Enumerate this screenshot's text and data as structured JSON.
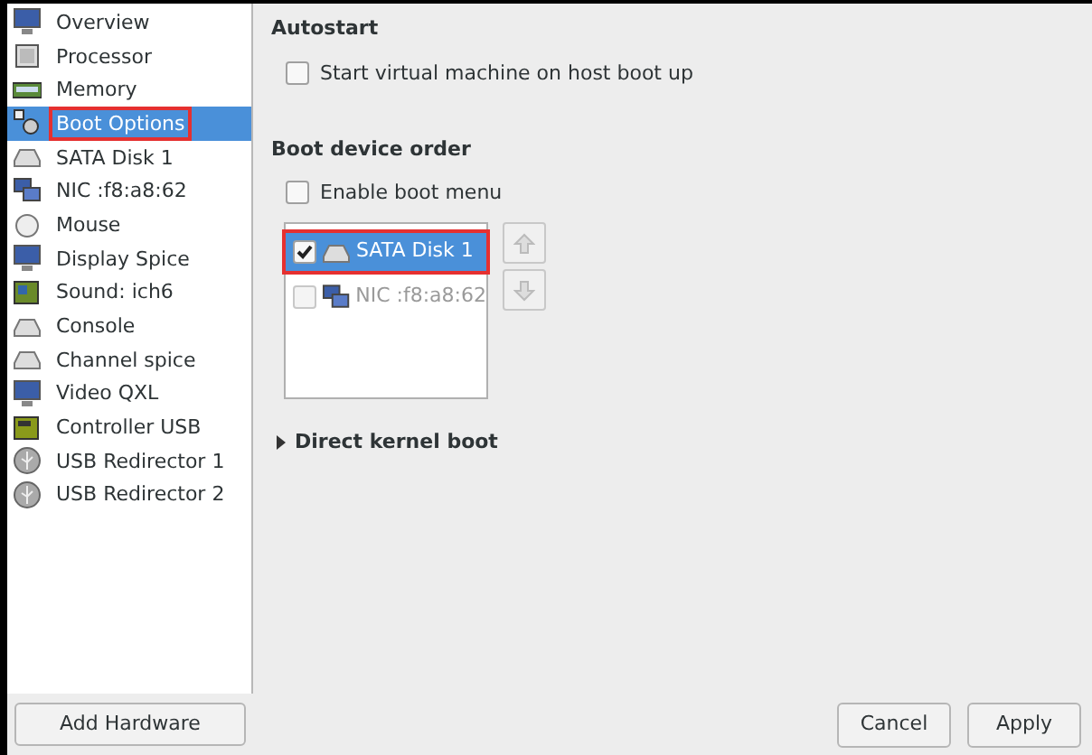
{
  "sidebar": {
    "items": [
      {
        "label": "Overview",
        "selected": false,
        "highlighted": false
      },
      {
        "label": "Processor",
        "selected": false,
        "highlighted": false
      },
      {
        "label": "Memory",
        "selected": false,
        "highlighted": false
      },
      {
        "label": "Boot Options",
        "selected": true,
        "highlighted": true
      },
      {
        "label": "SATA Disk 1",
        "selected": false,
        "highlighted": false
      },
      {
        "label": "NIC :f8:a8:62",
        "selected": false,
        "highlighted": false
      },
      {
        "label": "Mouse",
        "selected": false,
        "highlighted": false
      },
      {
        "label": "Display Spice",
        "selected": false,
        "highlighted": false
      },
      {
        "label": "Sound: ich6",
        "selected": false,
        "highlighted": false
      },
      {
        "label": "Console",
        "selected": false,
        "highlighted": false
      },
      {
        "label": "Channel spice",
        "selected": false,
        "highlighted": false
      },
      {
        "label": "Video QXL",
        "selected": false,
        "highlighted": false
      },
      {
        "label": "Controller USB",
        "selected": false,
        "highlighted": false
      },
      {
        "label": "USB Redirector 1",
        "selected": false,
        "highlighted": false
      },
      {
        "label": "USB Redirector 2",
        "selected": false,
        "highlighted": false
      }
    ],
    "add_button": "Add Hardware"
  },
  "autostart": {
    "heading": "Autostart",
    "option": {
      "label": "Start virtual machine on host boot up",
      "checked": false
    }
  },
  "boot_order": {
    "heading": "Boot device order",
    "menu_option": {
      "label": "Enable boot menu",
      "checked": false
    },
    "devices": [
      {
        "label": "SATA Disk 1",
        "checked": true,
        "selected": true,
        "highlighted": true,
        "disabled": false
      },
      {
        "label": "NIC :f8:a8:62",
        "checked": false,
        "selected": false,
        "highlighted": false,
        "disabled": true
      }
    ]
  },
  "direct_kernel_boot": {
    "label": "Direct kernel boot",
    "expanded": false
  },
  "buttons": [
    "Cancel",
    "Apply"
  ]
}
